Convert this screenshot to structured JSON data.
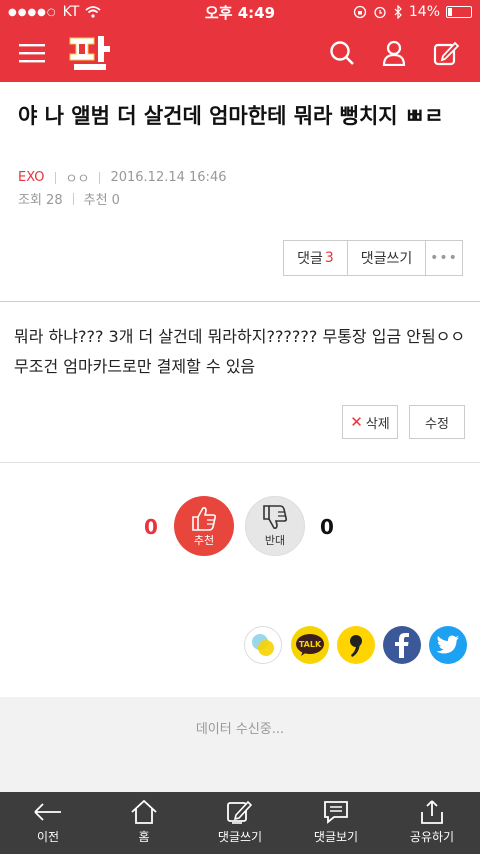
{
  "status_bar": {
    "carrier": "KT",
    "time": "오후 4:49",
    "battery": "14%"
  },
  "post": {
    "title": "야 나 앨범 더 살건데 엄마한테 뭐라 뻥치지 ㅃㄹ",
    "category": "EXO",
    "author": "ㅇㅇ",
    "date": "2016.12.14 16:46",
    "views_label": "조회 28",
    "recommend_label": "추천 0",
    "content": "뭐라 하냐??? 3개 더 살건데 뭐라하지?????? 무통장 입금 안됨ㅇㅇ 무조건 엄마카드로만 결제할 수 있음"
  },
  "comment_bar": {
    "comments_label": "댓글",
    "comments_count": "3",
    "write_label": "댓글쓰기",
    "more_label": "•••"
  },
  "edit": {
    "delete_label": "삭제",
    "modify_label": "수정"
  },
  "vote": {
    "up_count": "0",
    "up_label": "추천",
    "down_count": "0",
    "down_label": "반대"
  },
  "share": {
    "icons": [
      "kakaostory-icon",
      "kakaotalk-icon",
      "band-icon",
      "facebook-icon",
      "twitter-icon"
    ],
    "talk_label": "TALK"
  },
  "loading_text": "데이터 수신중...",
  "tab_bar": {
    "items": [
      {
        "label": "이전",
        "icon": "back-arrow-icon"
      },
      {
        "label": "홈",
        "icon": "home-icon"
      },
      {
        "label": "댓글쓰기",
        "icon": "write-comment-icon"
      },
      {
        "label": "댓글보기",
        "icon": "view-comments-icon"
      },
      {
        "label": "공유하기",
        "icon": "share-icon"
      }
    ]
  },
  "colors": {
    "brand": "#e8343d",
    "tabbar": "#3d3d3d"
  }
}
